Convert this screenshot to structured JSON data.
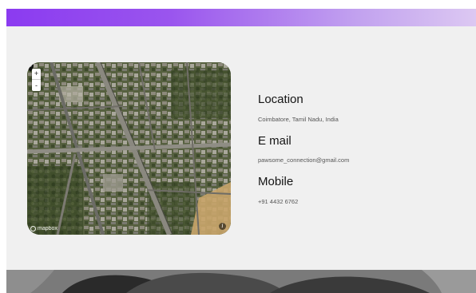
{
  "map": {
    "zoom_in_label": "+",
    "zoom_out_label": "-",
    "attribution_logo": "mapbox",
    "info_label": "i",
    "pin_icon": "map-pin-icon"
  },
  "contact": {
    "location_heading": "Location",
    "location_value": "Coimbatore, Tamil Nadu, India",
    "email_heading": "E mail",
    "email_value": "pawsome_connection@gmail.com",
    "mobile_heading": "Mobile",
    "mobile_value": "+91 4432 6762"
  },
  "colors": {
    "header_gradient_start": "#8b3bf0",
    "header_gradient_end": "#dcc8f2",
    "panel_background": "#f0f0f0",
    "heading_text": "#141414",
    "detail_text": "#555555"
  }
}
